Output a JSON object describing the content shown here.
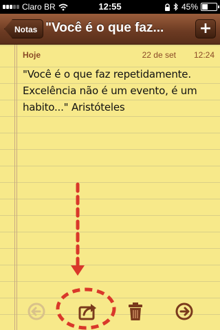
{
  "status_bar": {
    "carrier": "Claro BR",
    "time": "12:55",
    "battery": "45%",
    "battery_level": 0.45
  },
  "nav": {
    "back_label": "Notas",
    "title": "\"Você é o que faz...",
    "add_label": "+"
  },
  "note": {
    "day": "Hoje",
    "date": "22 de set",
    "time": "12:24",
    "body": "\"Você é o que faz repetidamente. Excelência não é um evento, é um habito...\" Aristóteles"
  },
  "toolbar": {
    "icons": [
      "previous-icon",
      "share-icon",
      "trash-icon",
      "next-icon"
    ]
  },
  "colors": {
    "paper": "#f7e98a",
    "nav_brown": "#6b3a22",
    "annotation_red": "#d9382a",
    "icon_brown": "#7a3a1c"
  }
}
